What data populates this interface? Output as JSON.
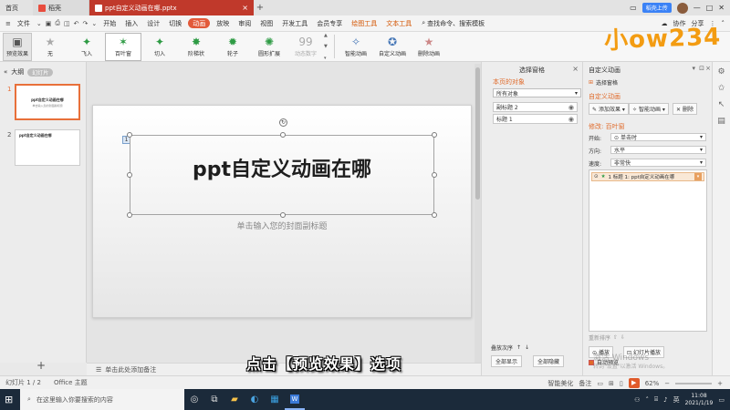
{
  "titlebar": {
    "tabs": [
      {
        "label": "首页",
        "icon": "home-icon"
      },
      {
        "label": "稻壳",
        "icon": "docer-icon"
      },
      {
        "label": "ppt自定义动画在哪.pptx",
        "icon": "ppt-file-icon"
      }
    ],
    "login_label": "稻壳上传",
    "right_num": "1"
  },
  "menubar": {
    "file_label": "文件",
    "items": [
      "开始",
      "插入",
      "设计",
      "切换",
      "动画",
      "放映",
      "审阅",
      "视图",
      "开发工具",
      "会员专享",
      "绘图工具",
      "文本工具"
    ],
    "active": "动画",
    "search_label": "查找命令、搜索模板",
    "right": [
      "协作",
      "分享"
    ]
  },
  "ribbon": {
    "buttons": [
      "预览效果",
      "无",
      "飞入",
      "百叶窗",
      "切入",
      "阶梯状",
      "轮子",
      "圆形扩展",
      "动态数字"
    ],
    "selected": "百叶窗",
    "right_buttons": [
      "智能动画",
      "自定义动画",
      "删除动画"
    ]
  },
  "logo": "小ow234",
  "left_panel": {
    "tab_outline": "大纲",
    "tab_slides": "幻灯片",
    "slides": [
      {
        "num": "1",
        "title": "ppt自定义动画在哪",
        "sub": "单击输入您的封面副标题"
      },
      {
        "num": "2",
        "title": "ppt自定义动画在哪"
      }
    ],
    "add_label": "+"
  },
  "slide": {
    "title": "ppt自定义动画在哪",
    "subtitle": "单击输入您的封面副标题",
    "anim_tag": "1"
  },
  "notes_placeholder": "单击此处添加备注",
  "statusbar": {
    "slide_info": "幻灯片 1 / 2",
    "theme": "Office 主题",
    "beautify": "智能美化",
    "notes": "备注",
    "zoom": "62%"
  },
  "selection_pane": {
    "title": "选择窗格",
    "section": "本页的对象",
    "filter": "所有对象",
    "objects": [
      "副标题 2",
      "标题 1"
    ],
    "reorder_label": "叠放次序",
    "show_all": "全部显示",
    "hide_all": "全部隐藏"
  },
  "anim_pane": {
    "title": "自定义动画",
    "select_pane": "选择窗格",
    "section": "自定义动画",
    "add_effect": "添加效果",
    "smart_anim": "智能动画",
    "delete": "删除",
    "modify": "修改: 百叶窗",
    "start_label": "开始:",
    "start_value": "单击时",
    "direction_label": "方向:",
    "direction_value": "水平",
    "speed_label": "速度:",
    "speed_value": "非常快",
    "entry": "1 标题 1: ppt自定义动画在哪",
    "reorder": "重新排序",
    "play": "播放",
    "slideshow": "幻灯片播放",
    "auto_preview": "自动预览"
  },
  "caption": "点击【预览效果】选项",
  "activate": {
    "line1": "激活 Windows",
    "line2": "转到\"设置\"以激活 Windows。"
  },
  "taskbar": {
    "search_placeholder": "在这里输入你要搜索的内容",
    "time": "11:08",
    "date": "2021/1/19",
    "lang": "英"
  }
}
